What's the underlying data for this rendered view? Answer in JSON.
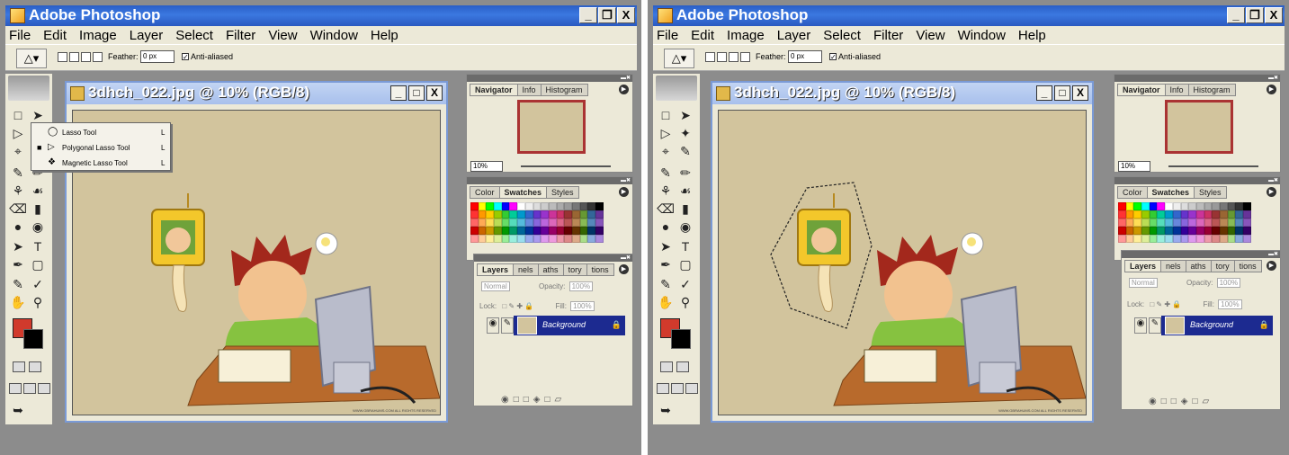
{
  "app": {
    "title": "Adobe Photoshop"
  },
  "window_buttons": [
    "_",
    "❐",
    "X"
  ],
  "menu": [
    "File",
    "Edit",
    "Image",
    "Layer",
    "Select",
    "Filter",
    "View",
    "Window",
    "Help"
  ],
  "options_bar": {
    "feather_label": "Feather:",
    "feather_value": "0 px",
    "antialias_label": "Anti-aliased",
    "antialias_checked": true
  },
  "document": {
    "title": "3dhch_022.jpg @ 10% (RGB/8)",
    "buttons": [
      "_",
      "□",
      "X"
    ],
    "copyright": "WWW.GBRAHUMS.COM ALL RIGHTS RESERVED"
  },
  "flyout": {
    "items": [
      {
        "label": "Lasso Tool",
        "key": "L",
        "selected": false,
        "icon": "lasso-icon"
      },
      {
        "label": "Polygonal Lasso Tool",
        "key": "L",
        "selected": true,
        "icon": "polygonal-lasso-icon"
      },
      {
        "label": "Magnetic Lasso Tool",
        "key": "L",
        "selected": false,
        "icon": "magnetic-lasso-icon"
      }
    ]
  },
  "navigator": {
    "tabs": [
      "Navigator",
      "Info",
      "Histogram"
    ],
    "zoom": "10%"
  },
  "swatches": {
    "tabs_left": [
      "Color",
      "Swatches",
      "Styles"
    ],
    "tabs_right": [
      "Color",
      "Swatches",
      "Styles"
    ]
  },
  "layers": {
    "tabs_left": [
      "Layers",
      "nels",
      "aths",
      "tory",
      "tions"
    ],
    "tabs_right": [
      "Layers",
      "nels",
      "aths",
      "tory",
      "tions"
    ],
    "blend_mode": "Normal",
    "opacity_label": "Opacity:",
    "opacity_value": "100%",
    "lock_label": "Lock:",
    "fill_label": "Fill:",
    "fill_value": "100%",
    "layer_name": "Background"
  },
  "colors": {
    "foreground": "#d13a2c",
    "background": "#000000",
    "canvas": "#d2c49d",
    "swatch_rows": [
      [
        "#ff0000",
        "#ffff00",
        "#00ff00",
        "#00ffff",
        "#0000ff",
        "#ff00ff",
        "#ffffff",
        "#eeeeee",
        "#dddddd",
        "#cccccc",
        "#bbbbbb",
        "#aaaaaa",
        "#999999",
        "#777777",
        "#555555",
        "#333333",
        "#000000"
      ],
      [
        "#ff3333",
        "#ff9900",
        "#ffcc00",
        "#99cc00",
        "#33cc33",
        "#00cc99",
        "#0099cc",
        "#3366cc",
        "#6633cc",
        "#9933cc",
        "#cc3399",
        "#cc3366",
        "#993333",
        "#996633",
        "#669933",
        "#336699",
        "#663399"
      ],
      [
        "#ff6666",
        "#ffaa55",
        "#ffdd55",
        "#bbdd55",
        "#66dd66",
        "#55ddbb",
        "#55bbdd",
        "#6688dd",
        "#8866dd",
        "#bb66dd",
        "#dd66bb",
        "#dd6688",
        "#bb5555",
        "#bb8855",
        "#88bb55",
        "#5588bb",
        "#8855bb"
      ],
      [
        "#cc0000",
        "#cc6600",
        "#cc9900",
        "#669900",
        "#009900",
        "#009966",
        "#006699",
        "#003399",
        "#330099",
        "#660099",
        "#990066",
        "#990033",
        "#660000",
        "#663300",
        "#336600",
        "#003366",
        "#330066"
      ],
      [
        "#ff9999",
        "#ffcc99",
        "#ffee99",
        "#ddee99",
        "#99ee99",
        "#99eedd",
        "#99ddee",
        "#99aaee",
        "#aa99ee",
        "#dd99ee",
        "#ee99dd",
        "#ee99aa",
        "#dd8888",
        "#ddaa88",
        "#aadd88",
        "#88aadd",
        "#aa88dd"
      ]
    ]
  }
}
